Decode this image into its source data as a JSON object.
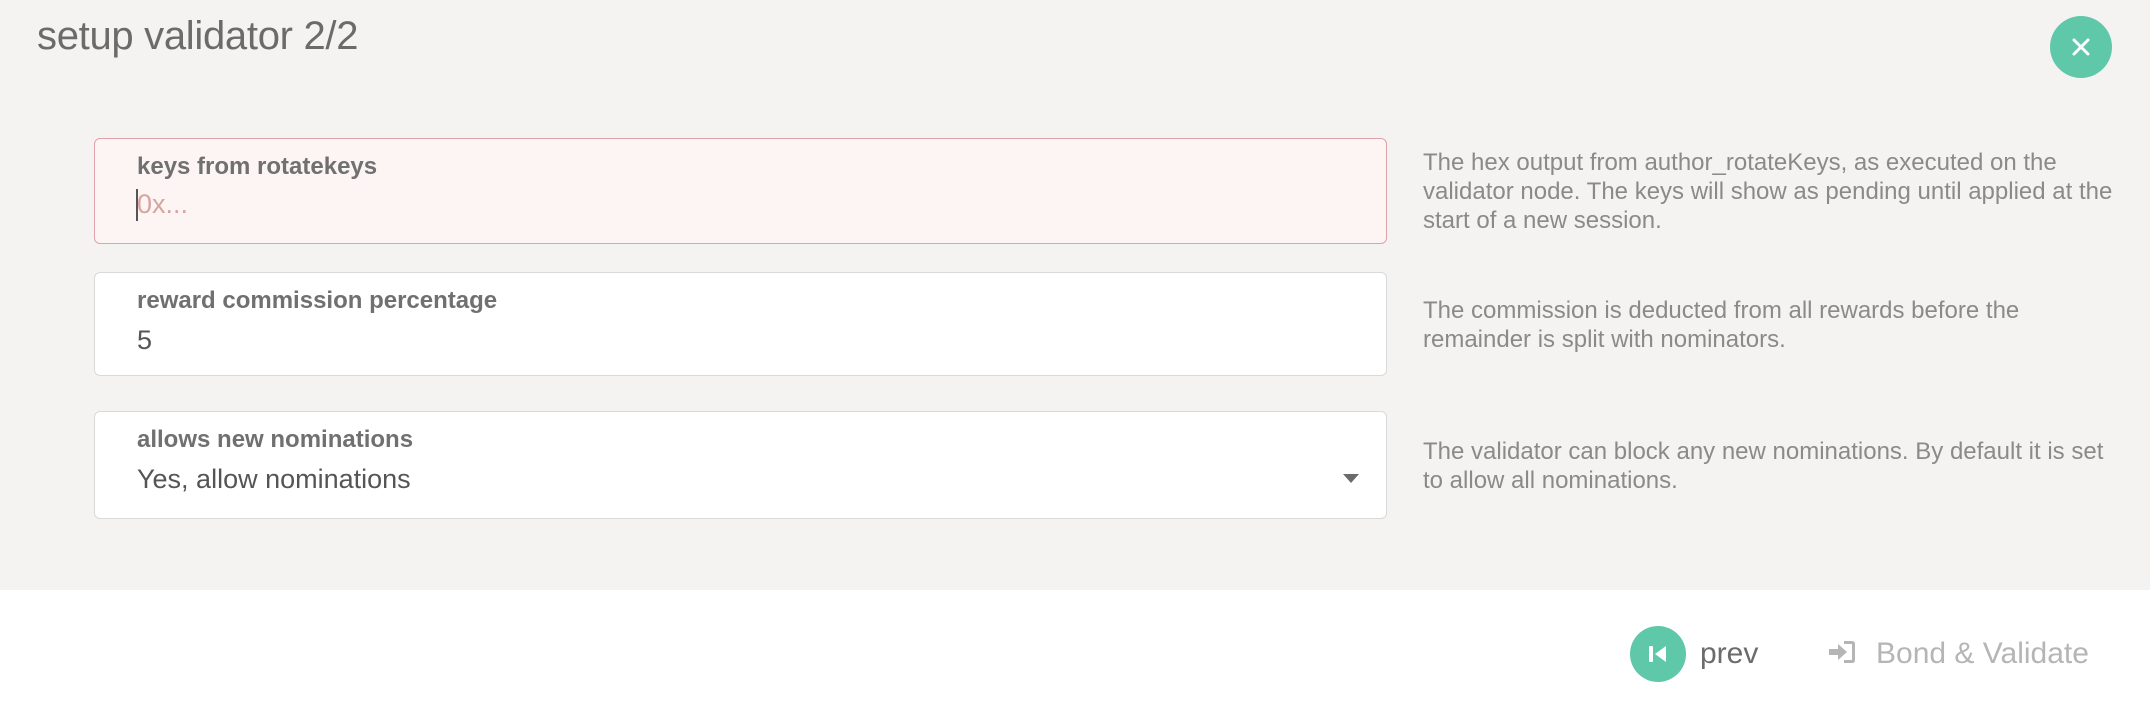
{
  "modal": {
    "title": "setup validator 2/2",
    "close_icon": "close-icon"
  },
  "fields": {
    "session_keys": {
      "label": "keys from rotatekeys",
      "value": "",
      "placeholder": "0x...",
      "state": "error",
      "help": "The hex output from author_rotateKeys, as executed on the validator node. The keys will show as pending until applied at the start of a new session."
    },
    "commission": {
      "label": "reward commission percentage",
      "value": "5",
      "help": "The commission is deducted from all rewards before the remainder is split with nominators."
    },
    "allow_nominations": {
      "label": "allows new nominations",
      "selected": "Yes, allow nominations",
      "help": "The validator can block any new nominations. By default it is set to allow all nominations."
    }
  },
  "actions": {
    "prev_label": "prev",
    "prev_icon": "step-backward-icon",
    "bond_label": "Bond & Validate",
    "bond_icon": "sign-in-icon",
    "bond_enabled": false
  },
  "colors": {
    "accent": "#5fc8a9",
    "error_border": "#e0a2a8",
    "error_background": "#fdf5f4",
    "panel_background": "#f4f3f2"
  }
}
